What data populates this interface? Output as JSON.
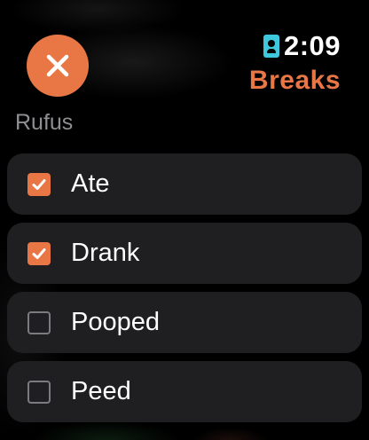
{
  "header": {
    "time": "2:09",
    "app_title": "Breaks",
    "close_icon": "xmark-icon",
    "status_icon": "badge-person-icon"
  },
  "section": {
    "title": "Rufus"
  },
  "items": [
    {
      "label": "Ate",
      "checked": true
    },
    {
      "label": "Drank",
      "checked": true
    },
    {
      "label": "Pooped",
      "checked": false
    },
    {
      "label": "Peed",
      "checked": false
    }
  ],
  "colors": {
    "accent": "#E87745",
    "status_icon": "#3EC8DE",
    "row_background": "#1F1F21",
    "secondary_text": "#8E8E93"
  }
}
